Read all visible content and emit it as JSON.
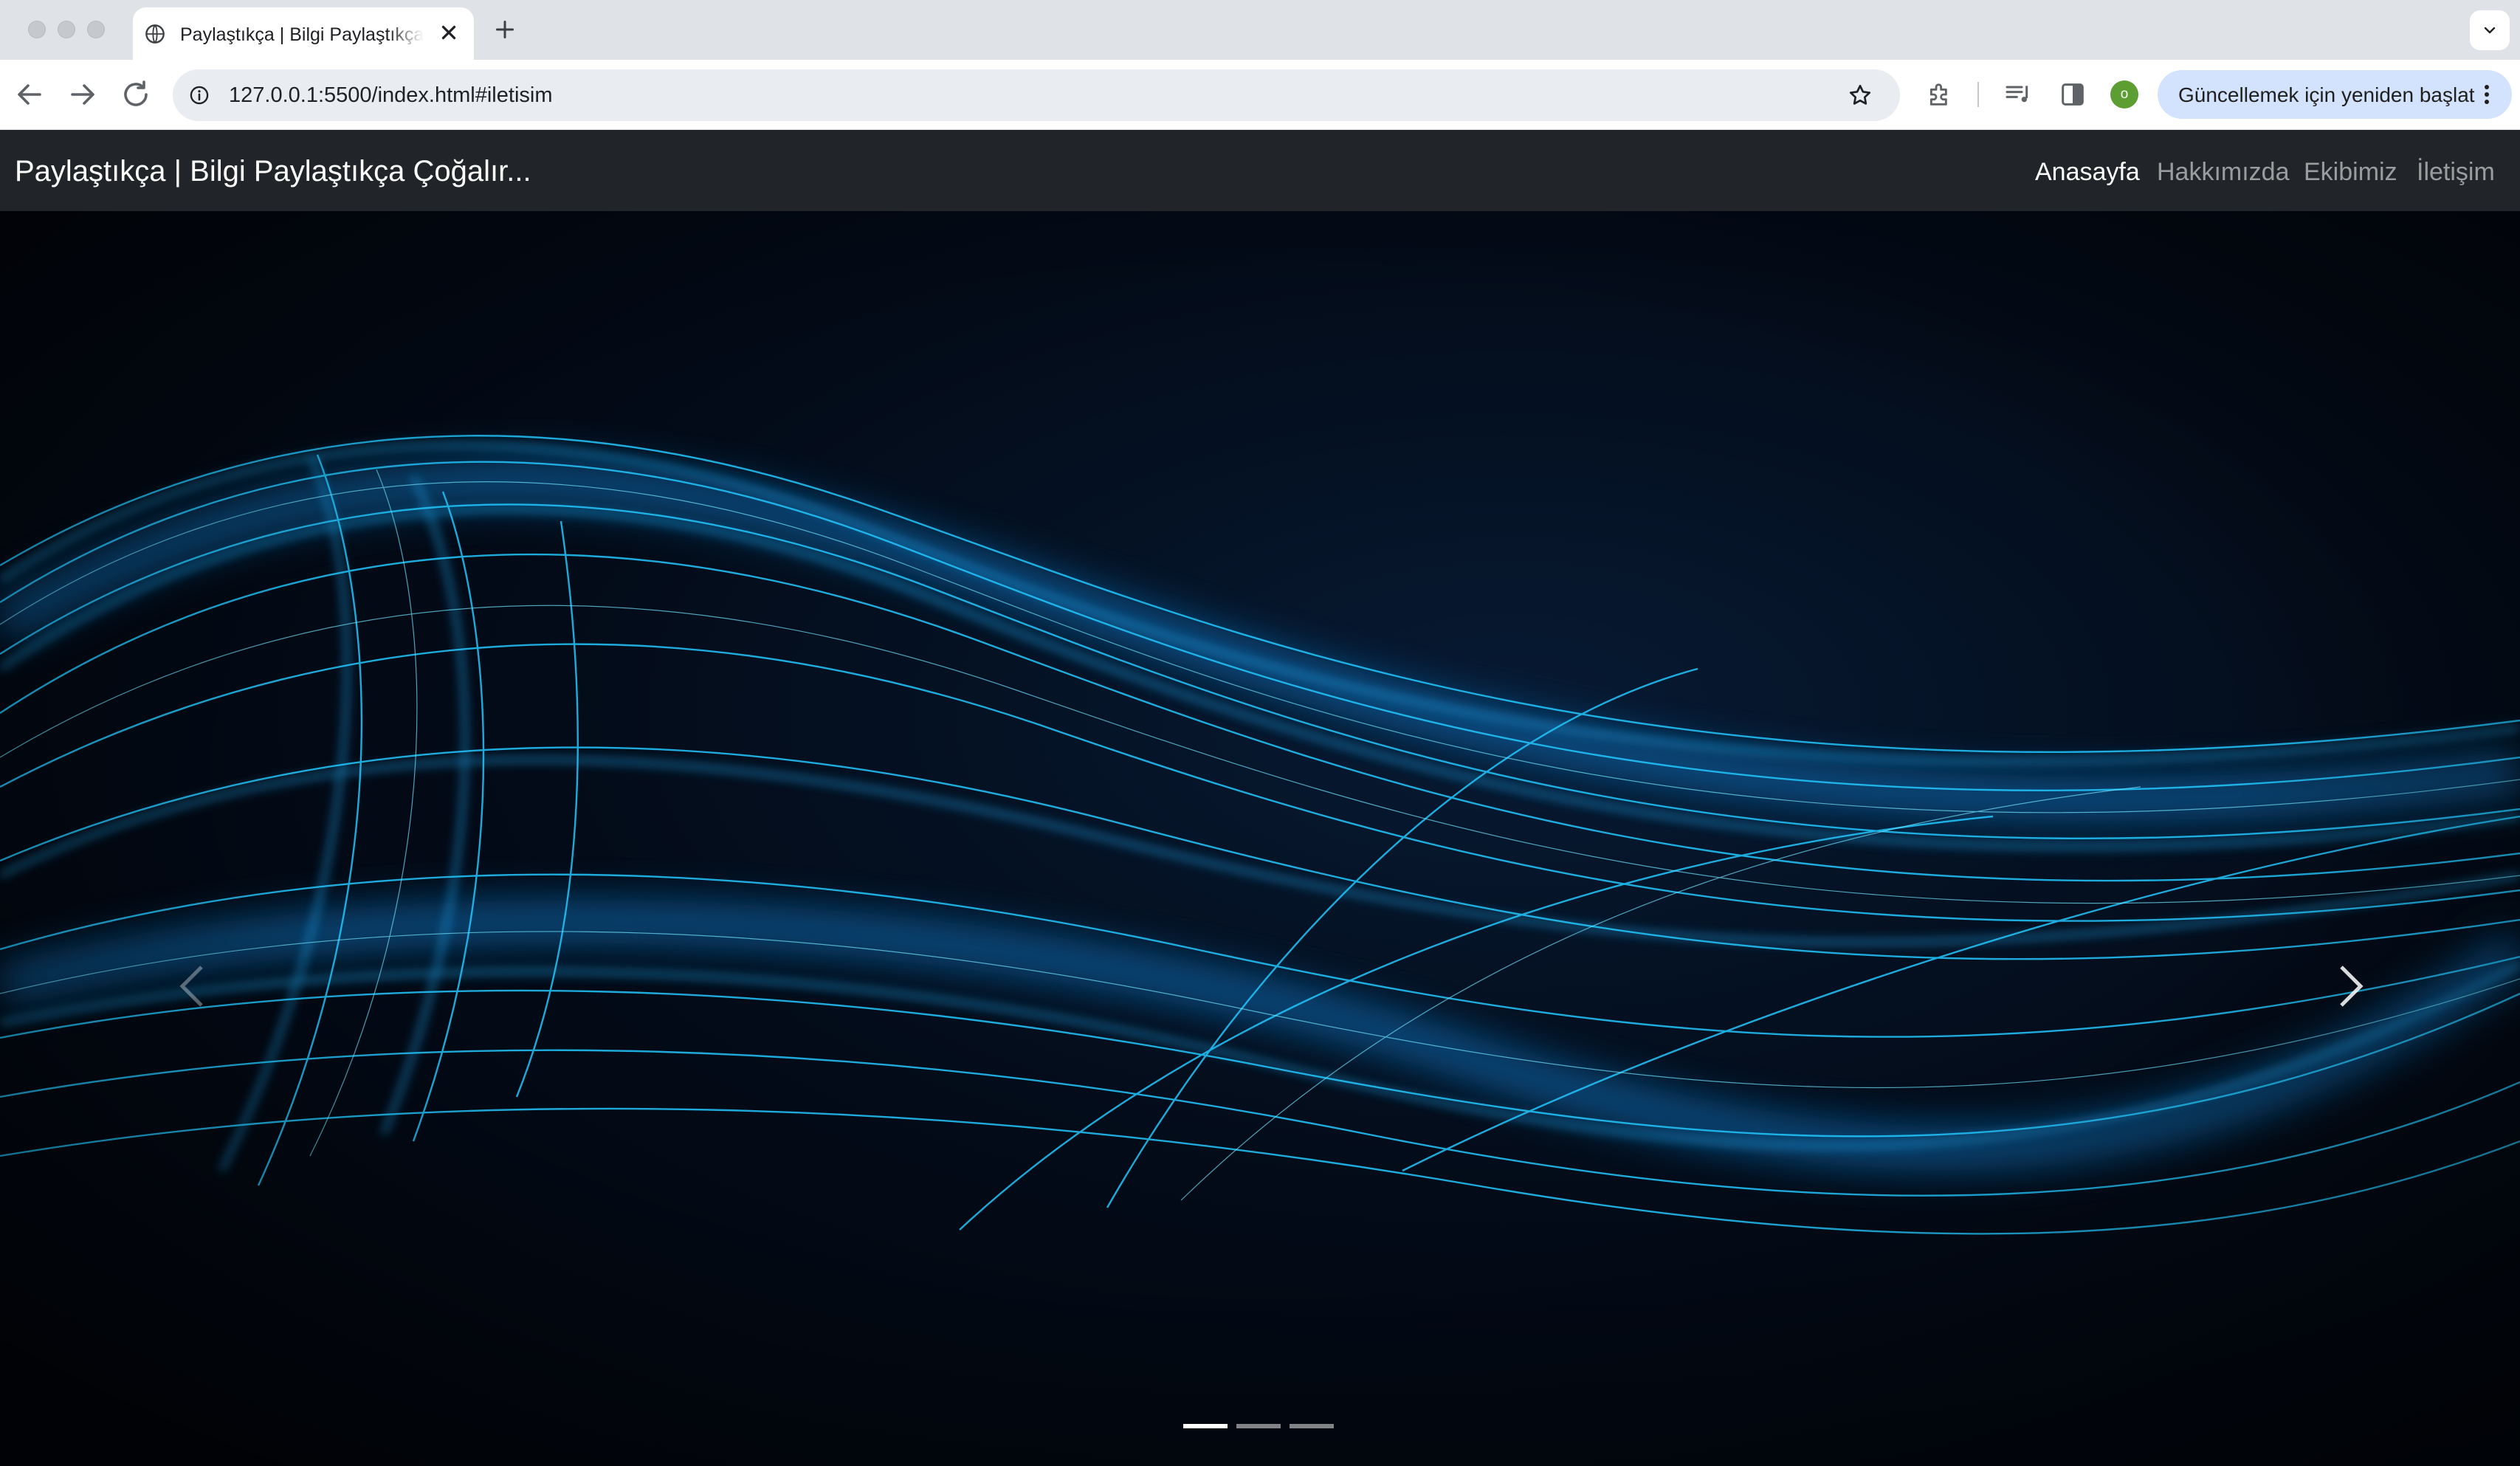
{
  "browser": {
    "tab": {
      "title": "Paylaştıkça | Bilgi Paylaştıkça Çoğalır..."
    },
    "address_bar": {
      "url": "127.0.0.1:5500/index.html#iletisim"
    },
    "profile_initial": "o",
    "update_button_label": "Güncellemek için yeniden başlat"
  },
  "site": {
    "brand": "Paylaştıkça | Bilgi Paylaştıkça Çoğalır...",
    "nav": [
      {
        "label": "Anasayfa",
        "active": true
      },
      {
        "label": "Hakkımızda",
        "active": false
      },
      {
        "label": "Ekibimiz",
        "active": false
      },
      {
        "label": "İletişim",
        "active": false
      }
    ]
  },
  "carousel": {
    "slide_count": 3,
    "active_slide": 1,
    "controls": [
      "prev",
      "next"
    ]
  },
  "colors": {
    "navbar_bg": "#212529",
    "hero_bg": "#02060f",
    "wave_accent": "#19c8ff"
  }
}
